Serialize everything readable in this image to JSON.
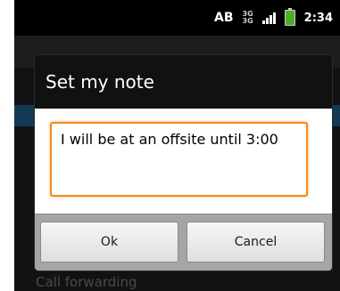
{
  "status_bar": {
    "indicator_label": "AB",
    "network_top": "3G",
    "network_bottom": "3G",
    "time": "2:34",
    "battery_color": "#4caf23"
  },
  "background": {
    "footer_label": "Call forwarding"
  },
  "dialog": {
    "title": "Set my note",
    "note_value": "I will be at an offsite until 3:00",
    "accent_color": "#f08c1a",
    "ok_label": "Ok",
    "cancel_label": "Cancel"
  }
}
